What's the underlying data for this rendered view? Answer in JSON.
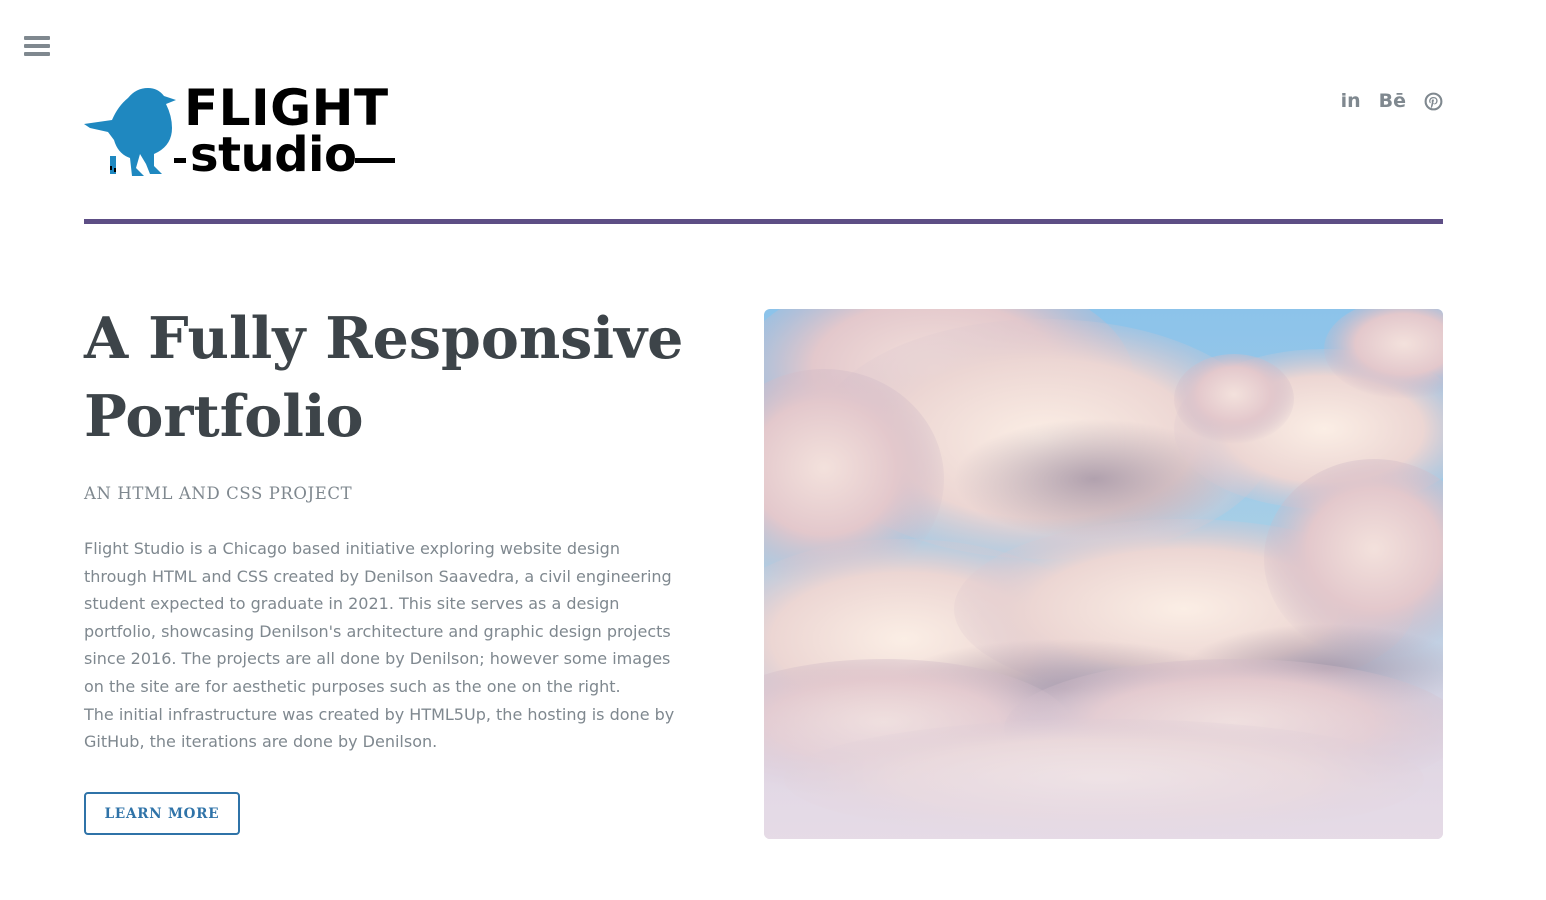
{
  "nav": {
    "menu_icon": "hamburger-menu-icon"
  },
  "header": {
    "logo": {
      "word_top": "FLIGHT",
      "word_bottom": "studio",
      "bird_color": "#1f88c0"
    },
    "socials": [
      {
        "name": "linkedin",
        "label": "in",
        "icon": "linkedin-icon"
      },
      {
        "name": "behance",
        "label": "Bē",
        "icon": "behance-icon"
      },
      {
        "name": "pinterest",
        "label": "",
        "icon": "pinterest-icon"
      }
    ]
  },
  "colors": {
    "divider": "#5d4e85",
    "heading": "#3d4449",
    "muted_text": "#7f888f",
    "accent": "#2f73a8"
  },
  "main": {
    "title_line1": "A Fully Responsive",
    "title_line2": "Portfolio",
    "subtitle": "AN HTML AND CSS PROJECT",
    "paragraph1": "Flight Studio is a Chicago based initiative exploring website design through HTML and CSS created by Denilson Saavedra, a civil engineering student expected to graduate in 2021. This site serves as a design portfolio, showcasing Denilson's architecture and graphic design projects since 2016. The projects are all done by Denilson; however some images on the site are for aesthetic purposes such as the one on the right.",
    "paragraph2": "The initial infrastructure was created by HTML5Up, the hosting is done by GitHub, the iterations are done by Denilson.",
    "cta_label": "LEARN MORE"
  },
  "hero": {
    "image_subject": "pastel clouds in blue sky"
  }
}
